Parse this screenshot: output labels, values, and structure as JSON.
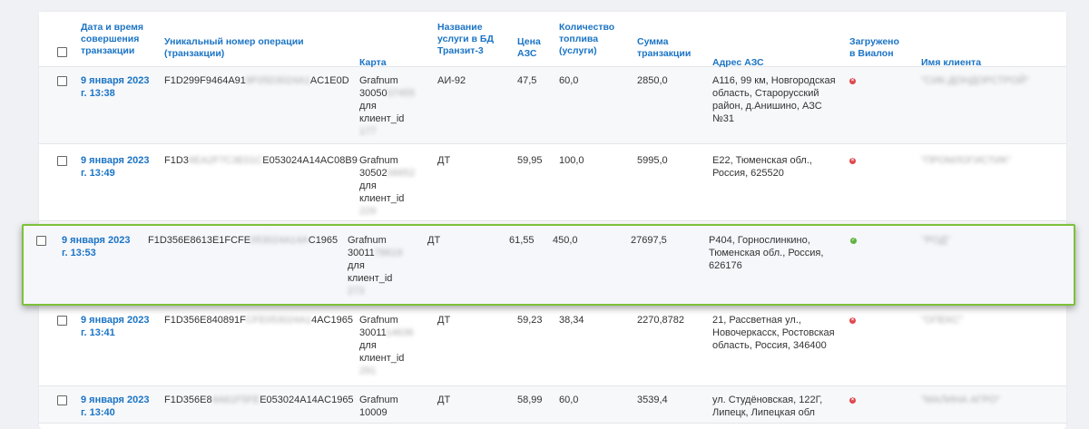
{
  "colors": {
    "header_text": "#1b74c5",
    "highlight_border": "#7cc13a",
    "status_no": "#e0474d",
    "status_yes": "#5db33c"
  },
  "table": {
    "headers": {
      "datetime": [
        "Дата и время",
        "совершения",
        "транзакции"
      ],
      "op_number": [
        "Уникальный номер операции",
        "(транзакции)"
      ],
      "card": [
        "Карта"
      ],
      "service": [
        "Название",
        "услуги в БД",
        "Транзит-3"
      ],
      "price": [
        "Цена",
        "АЗС"
      ],
      "quantity": [
        "Количество",
        "топлива",
        "(услуги)"
      ],
      "sum": [
        "Сумма",
        "транзакции"
      ],
      "address": [
        "Адрес АЗС"
      ],
      "loaded": [
        "Загружено",
        "в Виалон"
      ],
      "client": [
        "Имя клиента"
      ]
    },
    "rows": [
      {
        "date": [
          "9 января 2023",
          "г. 13:38"
        ],
        "op": [
          "F1D299F9464A91",
          "9F05D3024A1",
          "AC1E0D"
        ],
        "card": [
          "Grafnum",
          "30050",
          "07455",
          "для",
          "клиент_id",
          "177"
        ],
        "service": "АИ-92",
        "price": "47,5",
        "qty": "60,0",
        "sum": "2850,0",
        "address": "А116, 99 км, Новгородская область, Старорусский район, д.Анишино, АЗС №31",
        "loaded": false,
        "loaded_icon": "x-circle-icon",
        "client": "\"СИК-ДОНДОРСТРОЙ\""
      },
      {
        "date": [
          "9 января 2023",
          "г. 13:49"
        ],
        "op": [
          "F1D3",
          "6EA2F7C3E01C",
          "E053024A14AC08B9"
        ],
        "card": [
          "Grafnum",
          "30502",
          "06652",
          "для",
          "клиент_id",
          "229"
        ],
        "service": "ДТ",
        "price": "59,95",
        "qty": "100,0",
        "sum": "5995,0",
        "address": "Е22, Тюменская обл., Россия, 625520",
        "loaded": false,
        "loaded_icon": "x-circle-icon",
        "client": "\"ПРОМЛОГИСТИК\""
      },
      {
        "date": [
          "9 января 2023",
          "г. 13:53"
        ],
        "op": [
          "F1D356E8613E1FCFE",
          "053024A14A",
          "C1965"
        ],
        "card": [
          "Grafnum",
          "30011",
          "78619",
          "для",
          "клиент_id",
          "273"
        ],
        "service": "ДТ",
        "price": "61,55",
        "qty": "450,0",
        "sum": "27697,5",
        "address": "Р404, Горнослинкино, Тюменская обл., Россия, 626176",
        "loaded": true,
        "loaded_icon": "check-circle-icon",
        "client": "\"РОД\""
      },
      {
        "date": [
          "9 января 2023",
          "г. 13:41"
        ],
        "op": [
          "F1D356E840891F",
          "CFE053024A1",
          "4AC1965"
        ],
        "card": [
          "Grafnum",
          "30011",
          "14636",
          "для",
          "клиент_id",
          "291"
        ],
        "service": "ДТ",
        "price": "59,23",
        "qty": "38,34",
        "sum": "2270,8782",
        "address": "21, Рассветная ул., Новочеркасск, Ростовская область, Россия, 346400",
        "loaded": false,
        "loaded_icon": "x-circle-icon",
        "client": "\"ОПЕКС\""
      },
      {
        "date": [
          "9 января 2023",
          "г. 13:40"
        ],
        "op": [
          "F1D356E8",
          "4A61F5FE",
          "E053024A14AC1965"
        ],
        "card": [
          "Grafnum",
          "10009",
          "",
          "",
          "",
          ""
        ],
        "service": "ДТ",
        "price": "58,99",
        "qty": "60,0",
        "sum": "3539,4",
        "address": "ул. Студёновская, 122Г, Липецк, Липецкая обл",
        "loaded": false,
        "loaded_icon": "x-circle-icon",
        "client": "\"МАЛИНА АГРО\""
      }
    ]
  }
}
